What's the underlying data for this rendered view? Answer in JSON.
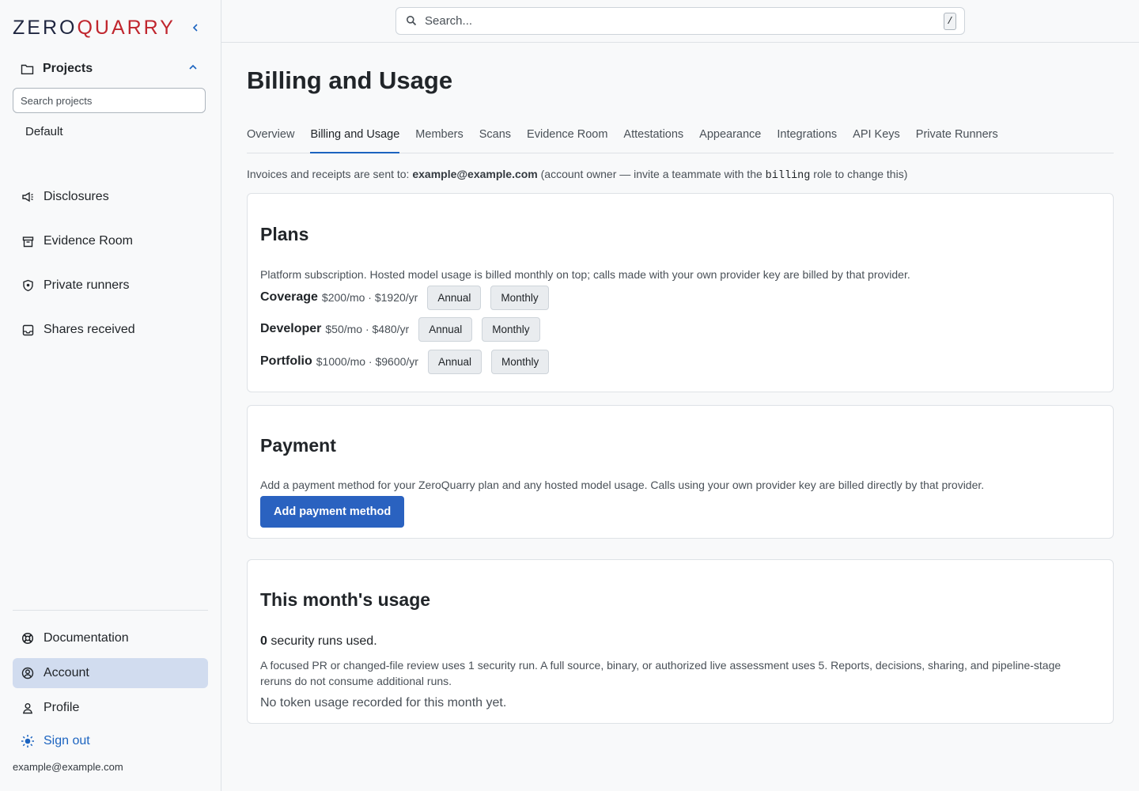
{
  "brand": {
    "name_part1": "ZERO",
    "name_part2": "QUARRY",
    "accent": "#c0262e",
    "primary": "#1f2640"
  },
  "sidebar": {
    "collapse_icon": "chevron-left-icon",
    "projects": {
      "label": "Projects",
      "search_placeholder": "Search projects",
      "items": [
        "Default"
      ]
    },
    "nav": [
      {
        "label": "Disclosures",
        "icon": "megaphone-icon"
      },
      {
        "label": "Evidence Room",
        "icon": "archive-icon"
      },
      {
        "label": "Private runners",
        "icon": "shield-icon"
      },
      {
        "label": "Shares received",
        "icon": "inbox-icon"
      }
    ],
    "bottom_nav": [
      {
        "label": "Documentation",
        "icon": "lifebuoy-icon"
      },
      {
        "label": "Account",
        "icon": "user-circle-icon",
        "active": true
      },
      {
        "label": "Profile",
        "icon": "user-icon"
      },
      {
        "label": "Sign out",
        "icon": "sun-icon"
      }
    ],
    "user_email": "example@example.com"
  },
  "topbar": {
    "search_placeholder": "Search...",
    "shortcut": "/"
  },
  "page": {
    "title": "Billing and Usage",
    "tabs": [
      {
        "label": "Overview"
      },
      {
        "label": "Billing and Usage",
        "active": true
      },
      {
        "label": "Members"
      },
      {
        "label": "Scans"
      },
      {
        "label": "Evidence Room"
      },
      {
        "label": "Attestations"
      },
      {
        "label": "Appearance"
      },
      {
        "label": "Integrations"
      },
      {
        "label": "API Keys"
      },
      {
        "label": "Private Runners"
      }
    ],
    "invoice": {
      "prefix": "Invoices and receipts are sent to:",
      "email": "example@example.com",
      "middle": "(account owner — invite a teammate with the",
      "role": "billing",
      "suffix": "role to change this)"
    }
  },
  "plans": {
    "title": "Plans",
    "description": "Platform subscription. Hosted model usage is billed monthly on top; calls made with your own provider key are billed by that provider.",
    "annual_label": "Annual",
    "monthly_label": "Monthly",
    "items": [
      {
        "name": "Coverage",
        "price": "$200/mo · $1920/yr"
      },
      {
        "name": "Developer",
        "price": "$50/mo · $480/yr"
      },
      {
        "name": "Portfolio",
        "price": "$1000/mo · $9600/yr"
      }
    ]
  },
  "payment": {
    "title": "Payment",
    "description": "Add a payment method for your ZeroQuarry plan and any hosted model usage. Calls using your own provider key are billed directly by that provider.",
    "button_label": "Add payment method"
  },
  "usage": {
    "title": "This month's usage",
    "runs_count": "0",
    "runs_label": "security runs used.",
    "note": "A focused PR or changed-file review uses 1 security run. A full source, binary, or authorized live assessment uses 5. Reports, decisions, sharing, and pipeline-stage reruns do not consume additional runs.",
    "token_text": "No token usage recorded for this month yet."
  }
}
